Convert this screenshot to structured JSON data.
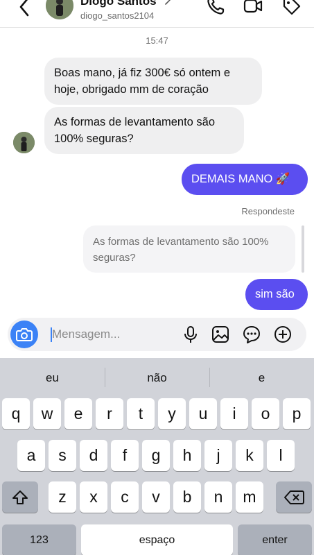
{
  "header": {
    "name": "Diogo Santos",
    "username": "diogo_santos2104",
    "icons": [
      "back-icon",
      "phone-icon",
      "video-icon",
      "tag-icon"
    ]
  },
  "thread": {
    "timestamp": "15:47",
    "messages": [
      {
        "from": "contact",
        "text": "Boas mano, já fiz 300€ só ontem e hoje, obrigado mm de coração"
      },
      {
        "from": "contact",
        "text": "As formas de levantamento são 100% seguras?"
      },
      {
        "from": "me",
        "text": "DEMAIS MANO 🚀"
      },
      {
        "from": "me",
        "text": "sim são"
      }
    ],
    "reply_label": "Respondeste",
    "quoted_text": "As formas de levantamento são 100% seguras?"
  },
  "composer": {
    "placeholder": "Mensagem...",
    "icons": [
      "camera-icon",
      "microphone-icon",
      "gallery-icon",
      "sticker-icon",
      "plus-icon"
    ]
  },
  "keyboard": {
    "suggestions": [
      "eu",
      "não",
      "e"
    ],
    "row1": [
      "q",
      "w",
      "e",
      "r",
      "t",
      "y",
      "u",
      "i",
      "o",
      "p"
    ],
    "row2": [
      "a",
      "s",
      "d",
      "f",
      "g",
      "h",
      "j",
      "k",
      "l"
    ],
    "row3": [
      "z",
      "x",
      "c",
      "v",
      "b",
      "n",
      "m"
    ],
    "numbers_label": "123",
    "space_label": "espaço",
    "enter_label": "enter"
  },
  "colors": {
    "accent": "#5b4ef0",
    "camera": "#3b82f6",
    "incoming_bubble": "#efeff0",
    "keyboard_bg": "#d1d3d9"
  }
}
